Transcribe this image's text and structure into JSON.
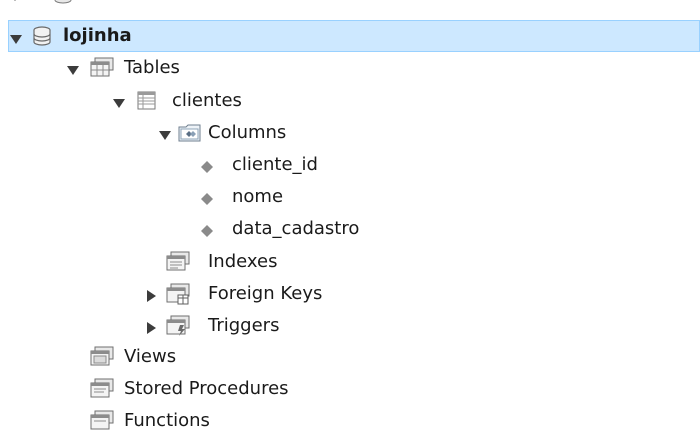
{
  "tree": {
    "database": {
      "label": "lojinha",
      "children": {
        "tables": {
          "label": "Tables",
          "table": {
            "label": "clientes",
            "columns": {
              "label": "Columns",
              "items": [
                "cliente_id",
                "nome",
                "data_cadastro"
              ]
            },
            "indexes": {
              "label": "Indexes"
            },
            "foreign_keys": {
              "label": "Foreign Keys"
            },
            "triggers": {
              "label": "Triggers"
            }
          }
        },
        "views": {
          "label": "Views"
        },
        "stored_procedures": {
          "label": "Stored Procedures"
        },
        "functions": {
          "label": "Functions"
        }
      }
    },
    "colors": {
      "selection_bg": "#cde8ff",
      "selection_border": "#99d1ff",
      "twisty": "#3c3c3c",
      "column_diamond": "#8a8a8a"
    }
  }
}
